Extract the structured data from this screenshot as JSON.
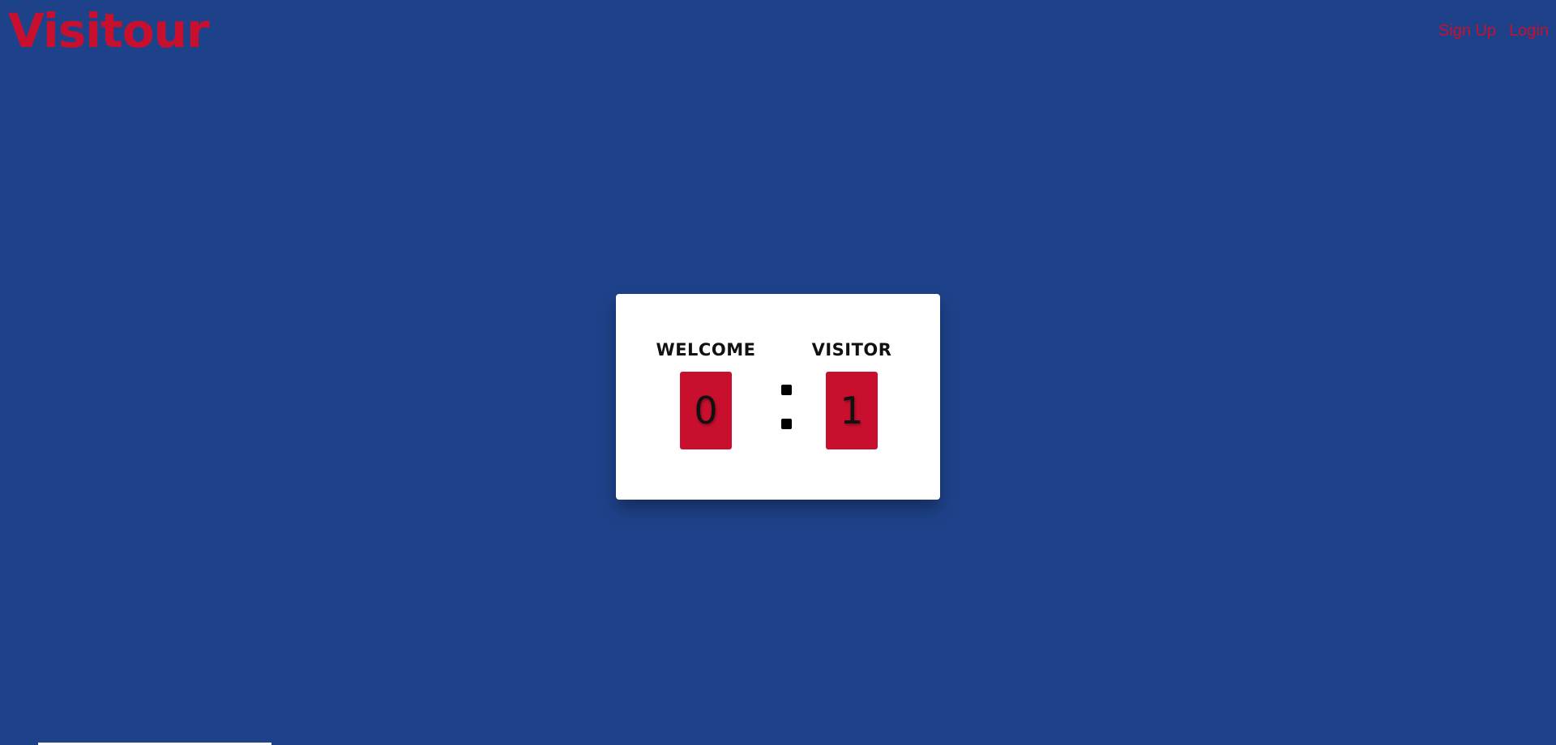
{
  "header": {
    "logo_text": "Visitour",
    "nav": {
      "sign_up_label": "Sign Up",
      "login_label": "Login"
    }
  },
  "scoreboard": {
    "home": {
      "name": "WELCOME",
      "score": "0"
    },
    "separator": ":",
    "away": {
      "name": "VISITOR",
      "score": "1"
    }
  },
  "colors": {
    "background": "#1e428a",
    "accent": "#c8102e",
    "card": "#ffffff"
  }
}
